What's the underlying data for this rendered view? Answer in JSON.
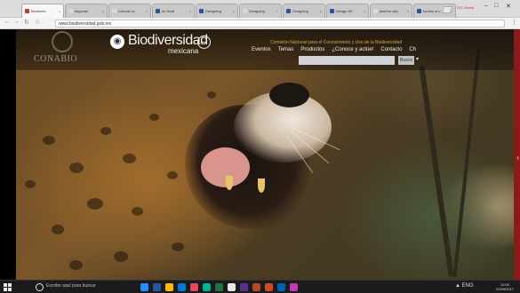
{
  "browser": {
    "tabs": [
      {
        "label": "Biodivers",
        "active": true,
        "favicon_color": "#c0392b"
      },
      {
        "label": "segundo",
        "active": false,
        "favicon_color": "#d9d9d9"
      },
      {
        "label": "robovat cu",
        "active": false,
        "favicon_color": "#d9d9d9"
      },
      {
        "label": "de fondl",
        "active": false,
        "favicon_color": "#2b579a"
      },
      {
        "label": "Designing",
        "active": false,
        "favicon_color": "#2b579a"
      },
      {
        "label": "Designing",
        "active": false,
        "favicon_color": "#d9d9d9"
      },
      {
        "label": "Designing",
        "active": false,
        "favicon_color": "#2b579a"
      },
      {
        "label": "Design Kit",
        "active": false,
        "favicon_color": "#2b579a"
      },
      {
        "label": "diseñar sitio",
        "active": false,
        "favicon_color": "#d9d9d9"
      },
      {
        "label": "fondos ul c",
        "active": false,
        "favicon_color": "#2b579a"
      }
    ],
    "profile_label": "DIT Global",
    "window_controls": [
      "minimize",
      "maximize",
      "close"
    ],
    "address": "www.biodiversidad.gob.mx",
    "nav_icons": [
      "back-icon",
      "forward-icon",
      "reload-icon",
      "home-icon"
    ]
  },
  "site": {
    "org_name": "CONABIO",
    "logo_icon": "globe-icon",
    "title": "Biodiversidad",
    "subtitle": "mexicana",
    "toggle_icon": "minus-circle-icon",
    "tagline": "Comisión Nacional para el Conocimiento y Uso de la Biodiversidad",
    "nav": [
      "Eventos",
      "Temas",
      "Productos",
      "¿Conoce y actúe!",
      "Contacto",
      "Ch"
    ],
    "search": {
      "placeholder": "",
      "button_label": "Busca"
    }
  },
  "taskbar": {
    "search_placeholder": "Escribe aquí para buscar",
    "app_colors": [
      "#1e90ff",
      "#2b579a",
      "#ffb900",
      "#0078d7",
      "#e74856",
      "#00b294",
      "#217346",
      "#e6e6e6",
      "#5c2d91",
      "#b7472a",
      "#d24726",
      "#0063b1",
      "#c239b3"
    ],
    "tray_text": "▲ ENG",
    "time": "12:00",
    "date": "20/09/2017"
  }
}
